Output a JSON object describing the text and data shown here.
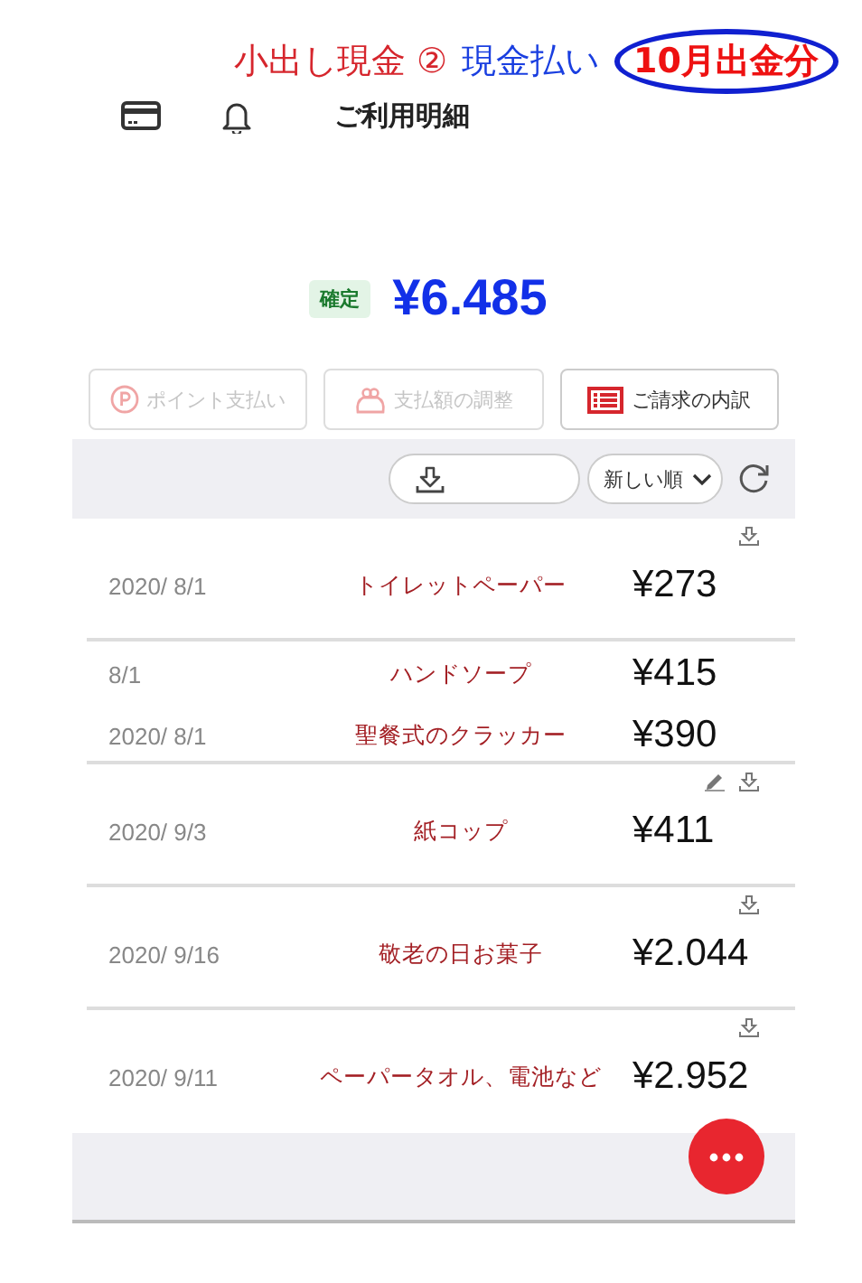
{
  "annotation": {
    "parts": [
      {
        "text": "小出し現金 ②",
        "kind": "note"
      },
      {
        "text": "現金払い",
        "kind": "method"
      },
      {
        "text": "10月出金分",
        "kind": "circled"
      }
    ]
  },
  "header": {
    "title": "ご利用明細"
  },
  "summary": {
    "status": "確定",
    "amount": "¥6.485"
  },
  "actions": [
    {
      "label": "ポイント支払い",
      "kind": "point",
      "disabled": true
    },
    {
      "label": "支払額の調整",
      "kind": "purse",
      "disabled": true
    },
    {
      "label": "ご請求の内訳",
      "kind": "list",
      "disabled": false
    }
  ],
  "toolbar": {
    "sort": "新しい順"
  },
  "rows": [
    {
      "date": "2020/ 8/1",
      "item": "トイレットペーパー",
      "amount": "¥273",
      "edit": false,
      "download": true,
      "separated": true
    },
    {
      "date": "8/1",
      "item": "ハンドソープ",
      "amount": "¥415",
      "edit": false,
      "download": false,
      "separated": false
    },
    {
      "date": "2020/ 8/1",
      "item": "聖餐式のクラッカー",
      "amount": "¥390",
      "edit": false,
      "download": false,
      "separated": true
    },
    {
      "date": "2020/ 9/3",
      "item": "紙コップ",
      "amount": "¥411",
      "edit": true,
      "download": true,
      "separated": true
    },
    {
      "date": "2020/ 9/16",
      "item": "敬老の日お菓子",
      "amount": "¥2.044",
      "edit": false,
      "download": true,
      "separated": true
    },
    {
      "date": "2020/ 9/11",
      "item": "ペーパータオル、電池など",
      "amount": "¥2.952",
      "edit": false,
      "download": true,
      "separated": false
    }
  ]
}
